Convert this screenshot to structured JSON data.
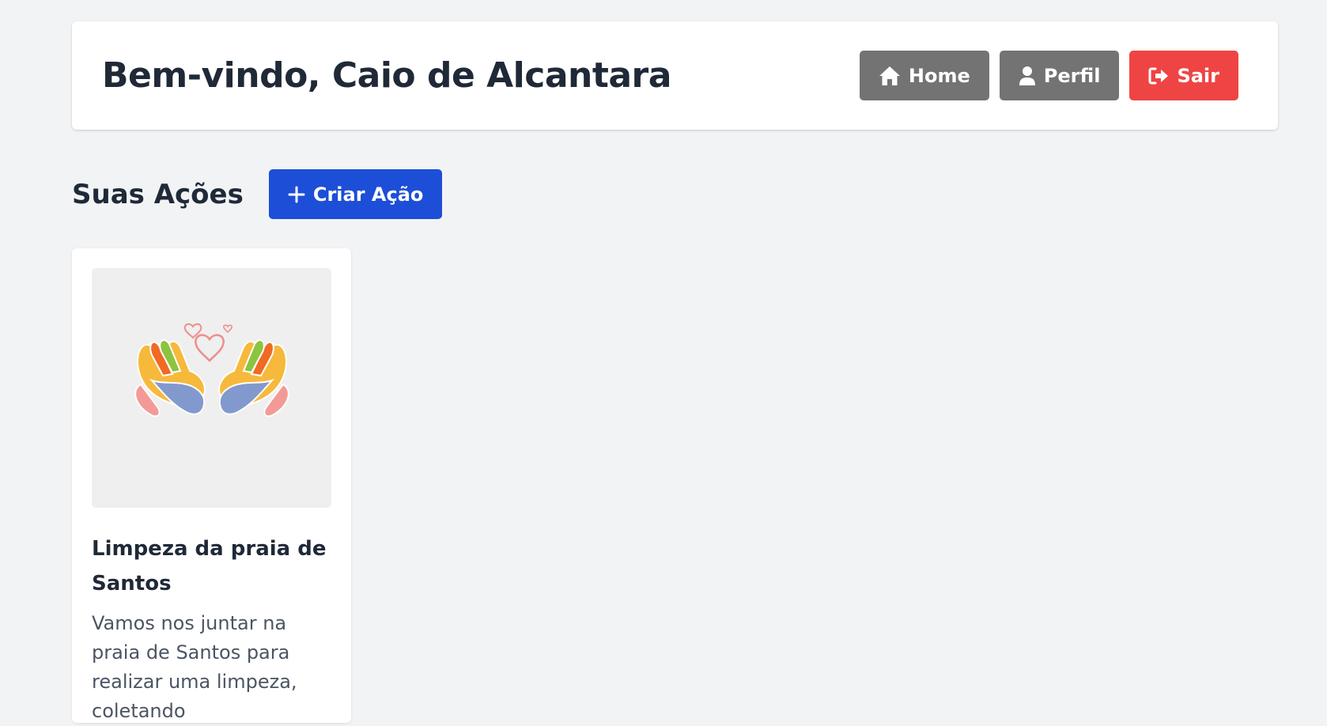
{
  "header": {
    "title": "Bem-vindo, Caio de Alcantara",
    "nav": {
      "home_label": "Home",
      "profile_label": "Perfil",
      "logout_label": "Sair"
    }
  },
  "actions_section": {
    "title": "Suas Ações",
    "create_label": "Criar Ação"
  },
  "cards": [
    {
      "image_icon": "helping-hands-heart-logo",
      "title": "Limpeza da praia de Santos",
      "description": "Vamos nos juntar na praia de Santos para realizar uma limpeza, coletando"
    }
  ],
  "icons": {
    "home": "home-icon",
    "profile": "user-icon",
    "logout": "sign-out-icon",
    "create": "plus-icon"
  },
  "colors": {
    "background": "#f2f3f5",
    "nav_button": "#737373",
    "logout_button": "#ef4444",
    "primary_button": "#1d4ed8"
  }
}
